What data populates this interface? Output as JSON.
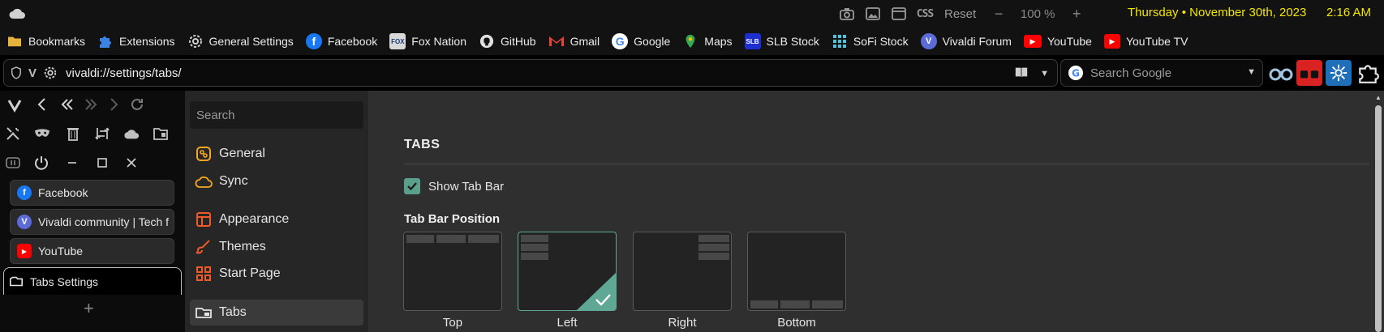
{
  "statusbar": {
    "cloud_icon": "cloud-icon",
    "tools": [
      "camera-icon",
      "image-icon",
      "panel-toggle-icon",
      "css-icon"
    ],
    "css_label": "CSS",
    "reset_label": "Reset",
    "zoom_out": "−",
    "zoom_value": "100 %",
    "zoom_in": "+",
    "date": "Thursday • November 30th, 2023",
    "time": "2:16 AM",
    "accent_color": "#f3e600"
  },
  "bookmarks": [
    {
      "label": "Bookmarks",
      "icon": "folder-icon"
    },
    {
      "label": "Extensions",
      "icon": "puzzle-icon"
    },
    {
      "label": "General Settings",
      "icon": "gear-icon"
    },
    {
      "label": "Facebook",
      "icon": "facebook-icon"
    },
    {
      "label": "Fox Nation",
      "icon": "fox-icon"
    },
    {
      "label": "GitHub",
      "icon": "github-icon"
    },
    {
      "label": "Gmail",
      "icon": "gmail-icon"
    },
    {
      "label": "Google",
      "icon": "google-icon"
    },
    {
      "label": "Maps",
      "icon": "maps-icon"
    },
    {
      "label": "SLB Stock",
      "icon": "slb-icon"
    },
    {
      "label": "SoFi Stock",
      "icon": "sofi-icon"
    },
    {
      "label": "Vivaldi Forum",
      "icon": "vivaldi-icon"
    },
    {
      "label": "YouTube",
      "icon": "youtube-icon"
    },
    {
      "label": "YouTube TV",
      "icon": "youtube-tv-icon"
    }
  ],
  "address": {
    "url": "vivaldi://settings/tabs/",
    "search_placeholder": "Search Google"
  },
  "tabs": [
    {
      "label": "Facebook",
      "icon": "facebook-icon"
    },
    {
      "label": "Vivaldi community | Tech f",
      "icon": "vivaldi-icon"
    },
    {
      "label": "YouTube",
      "icon": "youtube-icon"
    },
    {
      "label": "Tabs Settings",
      "icon": "tabs-settings-icon",
      "active": true
    }
  ],
  "new_tab": "+",
  "settings_nav": {
    "search_placeholder": "Search",
    "items": [
      {
        "label": "General",
        "icon": "general-icon"
      },
      {
        "label": "Sync",
        "icon": "sync-cloud-icon"
      },
      {
        "label": "Appearance",
        "icon": "appearance-icon"
      },
      {
        "label": "Themes",
        "icon": "themes-brush-icon"
      },
      {
        "label": "Start Page",
        "icon": "start-page-icon"
      },
      {
        "label": "Tabs",
        "icon": "tabs-icon",
        "selected": true
      }
    ]
  },
  "main": {
    "section_title": "TABS",
    "show_tab_bar": {
      "label": "Show Tab Bar",
      "checked": true
    },
    "position_title": "Tab Bar Position",
    "positions": [
      {
        "label": "Top",
        "selected": false
      },
      {
        "label": "Left",
        "selected": true
      },
      {
        "label": "Right",
        "selected": false
      },
      {
        "label": "Bottom",
        "selected": false
      }
    ],
    "accent_color": "#5fa896"
  }
}
